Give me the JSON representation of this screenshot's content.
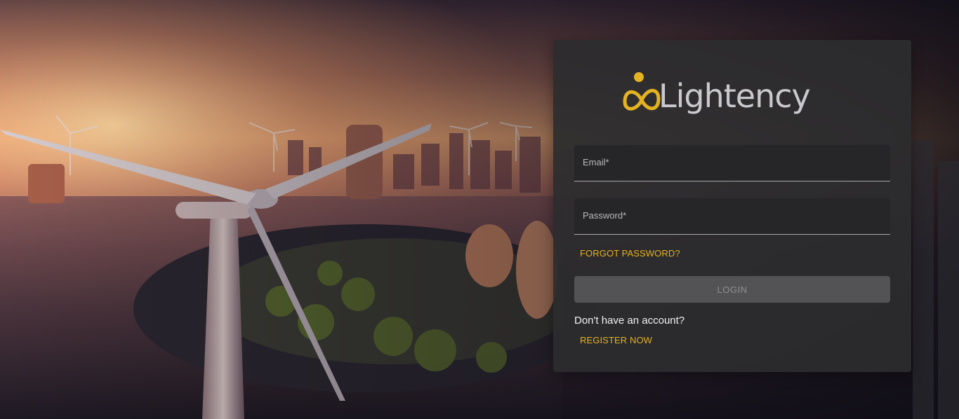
{
  "brand": {
    "name": "Lightency",
    "accent_color": "#e4b321"
  },
  "login": {
    "email_label": "Email*",
    "password_label": "Password*",
    "forgot_password": "FORGOT PASSWORD?",
    "login_button": "LOGIN",
    "no_account_text": "Don't have an account?",
    "register_link": "REGISTER NOW"
  },
  "icons": {
    "logo_mark": "infinity-logo-icon"
  }
}
